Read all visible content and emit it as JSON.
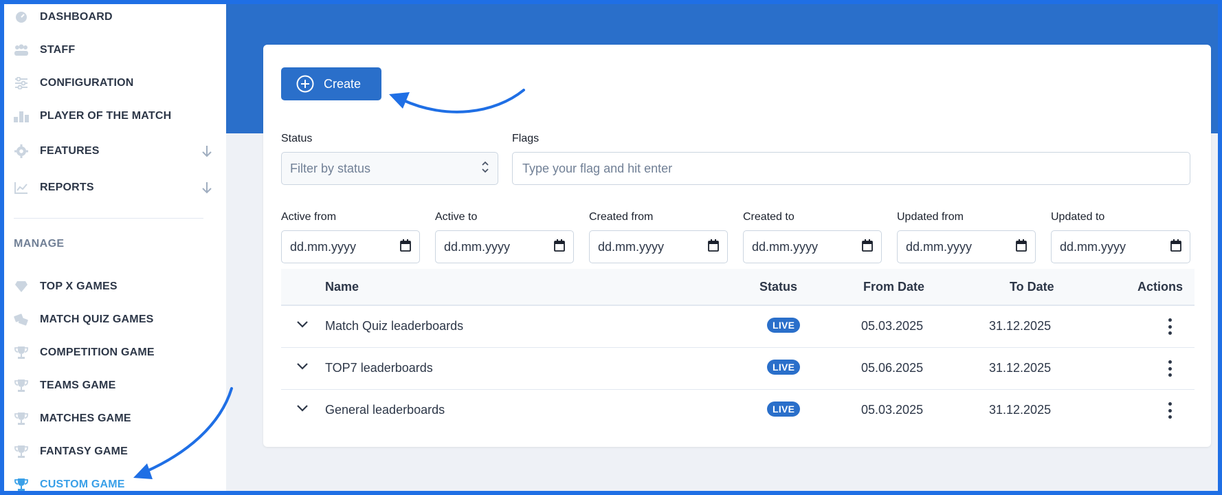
{
  "sidebar": {
    "items": [
      {
        "label": "DASHBOARD",
        "icon": "dashboard-icon"
      },
      {
        "label": "STAFF",
        "icon": "users-icon"
      },
      {
        "label": "CONFIGURATION",
        "icon": "sliders-icon"
      },
      {
        "label": "PLAYER OF THE MATCH",
        "icon": "podium-icon"
      },
      {
        "label": "FEATURES",
        "icon": "gear-icon"
      },
      {
        "label": "REPORTS",
        "icon": "chart-line-icon"
      }
    ],
    "manage_label": "MANAGE",
    "manage_items": [
      {
        "label": "TOP X GAMES",
        "icon": "diamond-icon"
      },
      {
        "label": "MATCH QUIZ GAMES",
        "icon": "tickets-icon"
      },
      {
        "label": "COMPETITION GAME",
        "icon": "trophy-icon"
      },
      {
        "label": "TEAMS GAME",
        "icon": "trophy-icon"
      },
      {
        "label": "MATCHES GAME",
        "icon": "trophy-icon"
      },
      {
        "label": "FANTASY GAME",
        "icon": "trophy-icon"
      },
      {
        "label": "CUSTOM GAME",
        "icon": "trophy-icon",
        "active": true
      }
    ]
  },
  "toolbar": {
    "create_label": "Create"
  },
  "filters": {
    "status_label": "Status",
    "status_placeholder": "Filter by status",
    "flags_label": "Flags",
    "flags_placeholder": "Type your flag and hit enter",
    "dates": [
      {
        "label": "Active from",
        "placeholder": "dd.mm.yyyy"
      },
      {
        "label": "Active to",
        "placeholder": "dd.mm.yyyy"
      },
      {
        "label": "Created from",
        "placeholder": "dd.mm.yyyy"
      },
      {
        "label": "Created to",
        "placeholder": "dd.mm.yyyy"
      },
      {
        "label": "Updated from",
        "placeholder": "dd.mm.yyyy"
      },
      {
        "label": "Updated to",
        "placeholder": "dd.mm.yyyy"
      }
    ]
  },
  "table": {
    "headers": {
      "name": "Name",
      "status": "Status",
      "from": "From Date",
      "to": "To Date",
      "actions": "Actions"
    },
    "rows": [
      {
        "name": "Match Quiz leaderboards",
        "status": "LIVE",
        "from": "05.03.2025",
        "to": "31.12.2025"
      },
      {
        "name": "TOP7 leaderboards",
        "status": "LIVE",
        "from": "05.06.2025",
        "to": "31.12.2025"
      },
      {
        "name": "General leaderboards",
        "status": "LIVE",
        "from": "05.03.2025",
        "to": "31.12.2025"
      }
    ]
  },
  "colors": {
    "accent": "#2a6fca",
    "active_nav": "#3aa0e8",
    "annotation_arrow": "#1f6fe5"
  }
}
